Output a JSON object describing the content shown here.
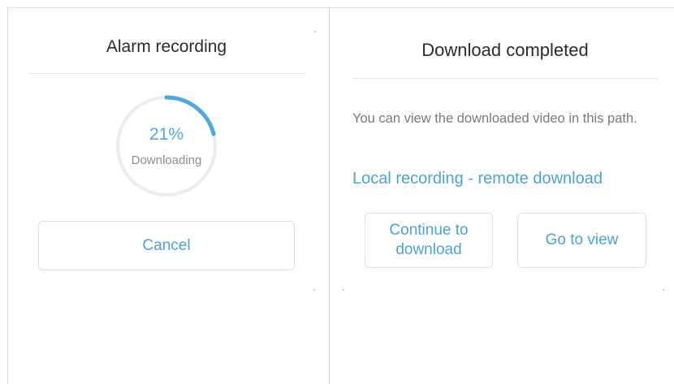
{
  "left_dialog": {
    "title": "Alarm recording",
    "progress": {
      "percent_label": "21%",
      "fraction": 0.21,
      "status_label": "Downloading"
    },
    "cancel_label": "Cancel"
  },
  "right_dialog": {
    "title": "Download completed",
    "message": "You can view the downloaded video in this path.",
    "path_link": "Local recording - remote download",
    "continue_label": "Continue to download",
    "go_to_view_label": "Go to view"
  },
  "colors": {
    "accent": "#4fa8dc",
    "track": "#ececec",
    "title_text": "#2b2b2b",
    "muted_text": "#7a7a7a"
  }
}
